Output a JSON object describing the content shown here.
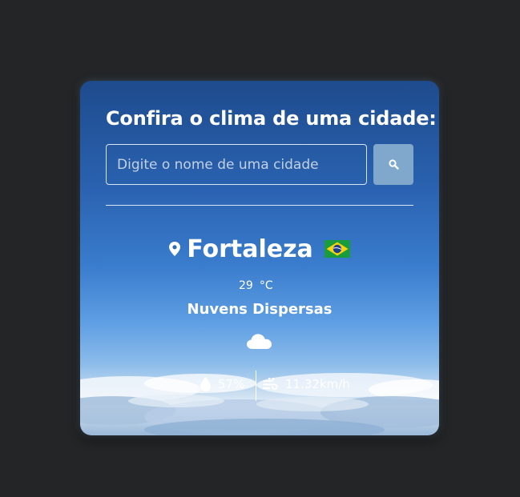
{
  "card": {
    "title": "Confira o clima de uma cidade:",
    "search": {
      "placeholder": "Digite o nome de uma cidade",
      "button_icon": "search-icon"
    },
    "weather": {
      "location_icon": "map-pin-icon",
      "city": "Fortaleza",
      "country_flag": "brazil-flag-icon",
      "temperature": "29",
      "temperature_unit": "°C",
      "description": "Nuvens Dispersas",
      "condition_icon": "cloud-icon",
      "humidity_icon": "droplet-icon",
      "humidity": "57%",
      "wind_icon": "wind-icon",
      "wind_speed": "11.32km/h"
    }
  },
  "colors": {
    "page_background": "#242526",
    "card_gradient_top": "#1e4b8d",
    "card_gradient_bottom": "#9ab8d9",
    "search_button": "#7fa8cc",
    "text": "#ffffff"
  }
}
